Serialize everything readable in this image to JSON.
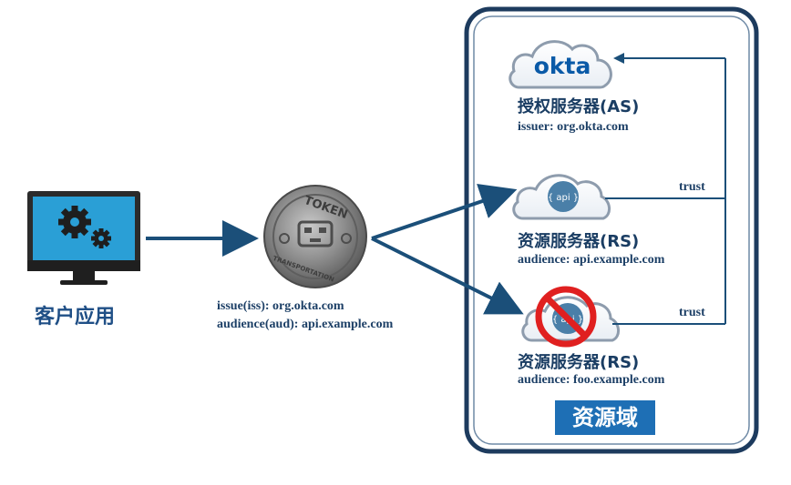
{
  "client": {
    "label": "客户应用",
    "icon": "monitor-gears-icon"
  },
  "token": {
    "coin_text_top": "TOKEN",
    "coin_text_bottom": "TRANSPORTATION",
    "claims": [
      "issue(iss): org.okta.com",
      "audience(aud): api.example.com"
    ]
  },
  "auth_server": {
    "logo_text": "okta",
    "title": "授权服务器(AS)",
    "subtitle": "issuer: org.okta.com"
  },
  "resource_server_1": {
    "cloud_text": "{ api }",
    "title": "资源服务器(RS)",
    "subtitle": "audience: api.example.com",
    "trust_label": "trust"
  },
  "resource_server_2": {
    "cloud_text": "{ api }",
    "title": "资源服务器(RS)",
    "subtitle": "audience: foo.example.com",
    "trust_label": "trust",
    "status_icon": "prohibited-icon"
  },
  "resource_domain": {
    "label": "资源域"
  },
  "colors": {
    "arrow": "#1b4f79",
    "frame": "#1d3b5e",
    "okta_blue": "#0a5aa7",
    "api_blue": "#4a7fa8",
    "prohibit_red": "#e02020",
    "domain_badge": "#1e6fb5"
  }
}
